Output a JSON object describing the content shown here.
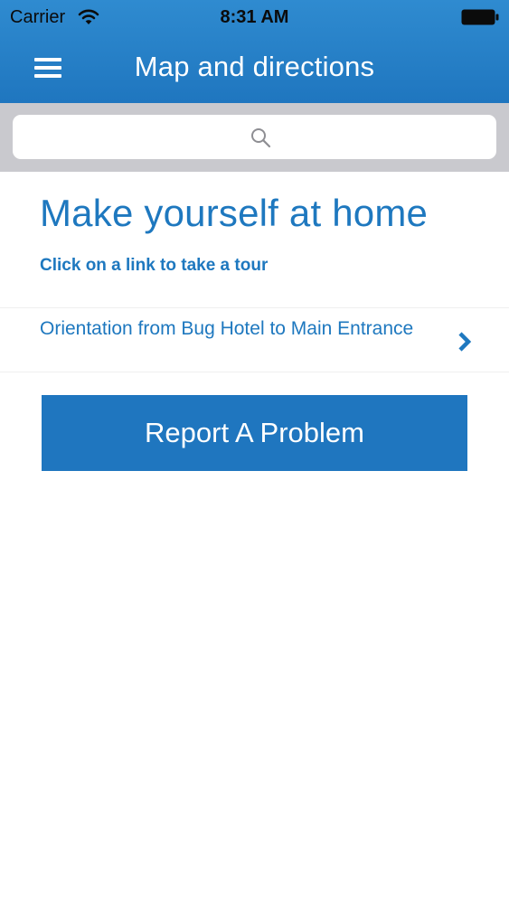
{
  "status_bar": {
    "carrier": "Carrier",
    "time": "8:31 AM",
    "wifi_icon": "wifi-icon",
    "battery_icon": "battery-icon"
  },
  "nav_bar": {
    "title": "Map and directions",
    "menu_icon": "hamburger-menu-icon",
    "background_color": "#1f76bf"
  },
  "search": {
    "placeholder": "",
    "icon": "search-icon"
  },
  "content": {
    "headline": "Make yourself at home",
    "subline": "Click on a link to take a tour",
    "tours": [
      {
        "label": "Orientation from Bug Hotel to Main Entrance",
        "icon": "chevron-right-icon"
      }
    ]
  },
  "actions": {
    "report_label": "Report A Problem"
  },
  "colors": {
    "accent": "#1e78bf",
    "search_bar_bg": "#c9c9ce",
    "button_bg": "#1f76bf"
  }
}
